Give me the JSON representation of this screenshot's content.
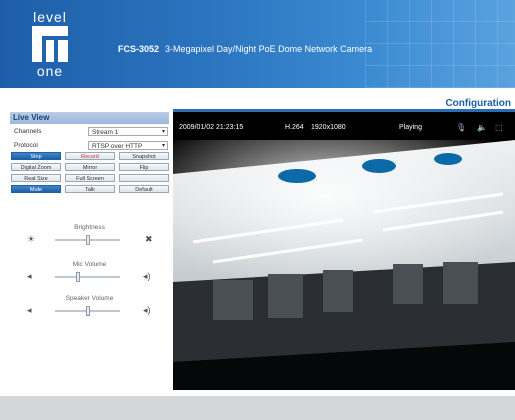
{
  "header": {
    "logo_top": "level",
    "logo_bottom": "one",
    "model": "FCS-3052",
    "description": "3-Megapixel Day/Night PoE Dome Network Camera"
  },
  "nav": {
    "configuration": "Configuration"
  },
  "live_view": {
    "title": "Live View",
    "channels_label": "Channels",
    "channels_value": "Stream 1",
    "protocol_label": "Protocol",
    "protocol_value": "RTSP over HTTP",
    "buttons": {
      "stop": "Stop",
      "record": "Record",
      "snapshot": "Snapshot",
      "digital_zoom": "Digital Zoom",
      "mirror": "Mirror",
      "flip": "Flip",
      "real_size": "Real Size",
      "full_screen": "Full Screen",
      "disabled": "",
      "mute": "Mute",
      "talk": "Talk",
      "default": "Default"
    },
    "sliders": {
      "brightness": {
        "label": "Brightness",
        "level": 0.5
      },
      "mic_volume": {
        "label": "Mic Volume",
        "level": 0.35
      },
      "speaker_volume": {
        "label": "Speaker Volume",
        "level": 0.5
      }
    }
  },
  "video": {
    "timestamp": "2009/01/02 21:23:15",
    "codec": "H.264",
    "resolution": "1920x1080",
    "status": "Playing"
  },
  "icons": [
    "mic-icon",
    "speaker-icon",
    "record-icon",
    "brightness-low-icon",
    "brightness-high-icon",
    "volume-low-icon",
    "volume-high-icon"
  ]
}
